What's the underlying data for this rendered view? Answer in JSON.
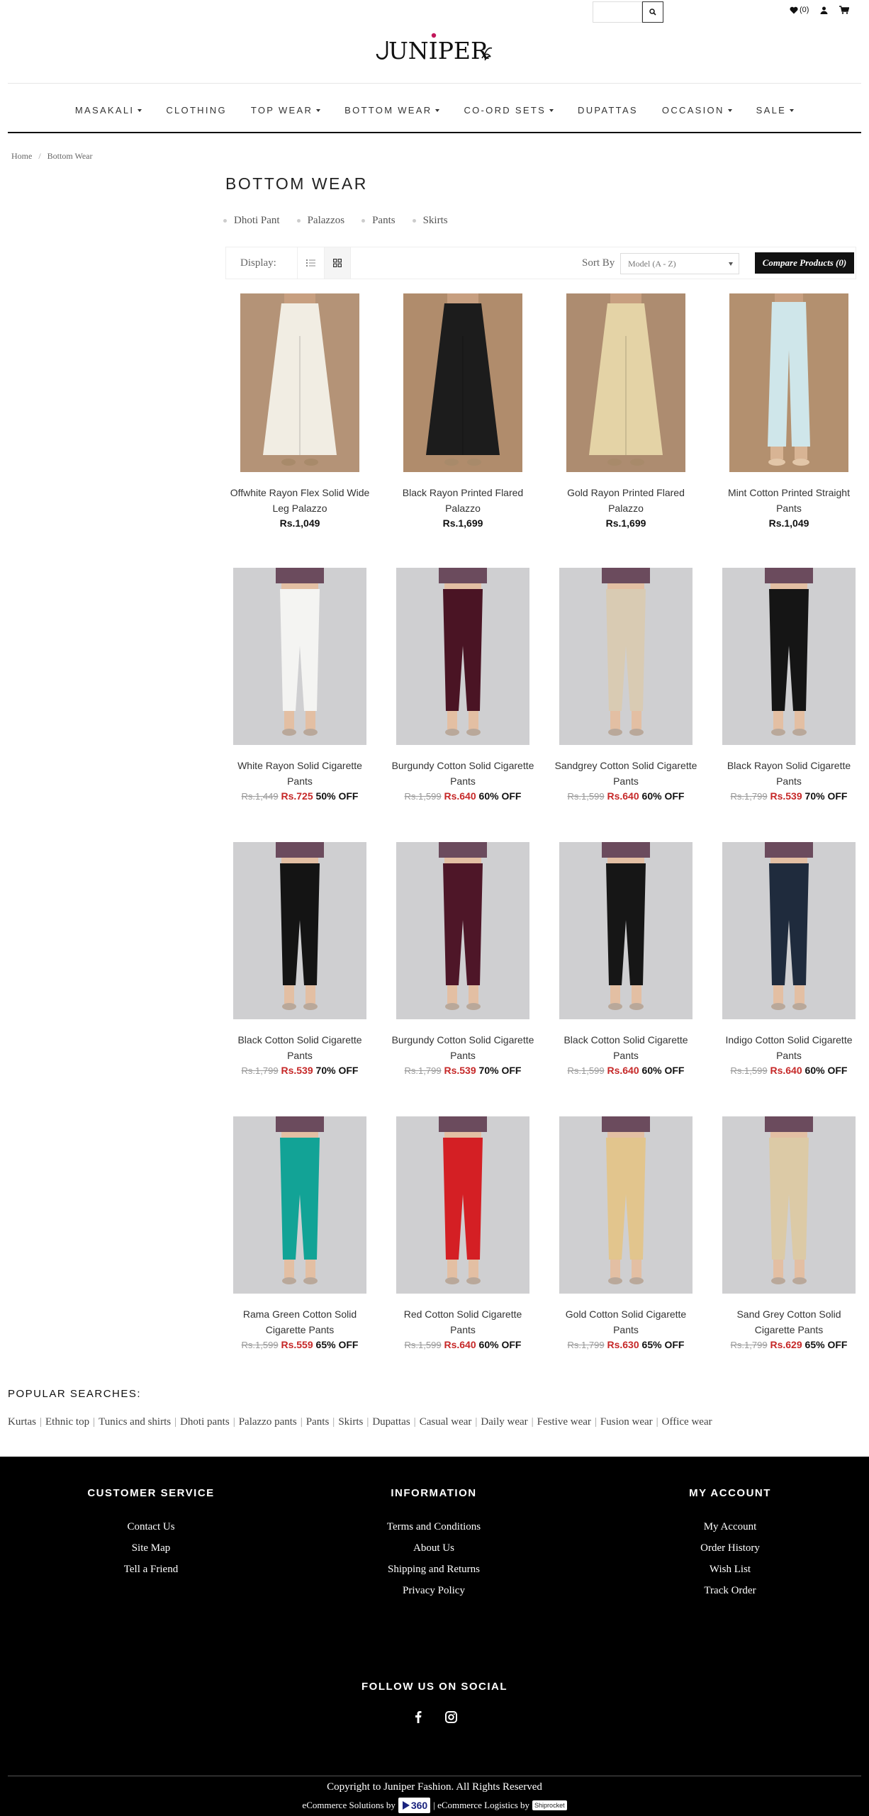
{
  "brand": {
    "logo_text": "JUNIPER"
  },
  "topbar": {
    "wishlist_count": "(0)"
  },
  "nav": [
    {
      "label": "MASAKALI",
      "dropdown": true
    },
    {
      "label": "CLOTHING",
      "dropdown": false
    },
    {
      "label": "TOP WEAR",
      "dropdown": true
    },
    {
      "label": "BOTTOM WEAR",
      "dropdown": true
    },
    {
      "label": "CO-ORD SETS",
      "dropdown": true
    },
    {
      "label": "DUPATTAS",
      "dropdown": false
    },
    {
      "label": "OCCASION",
      "dropdown": true
    },
    {
      "label": "SALE",
      "dropdown": true
    }
  ],
  "breadcrumb": {
    "home": "Home",
    "separator": "/",
    "current": "Bottom Wear"
  },
  "page_title": "BOTTOM WEAR",
  "subcategories": [
    "Dhoti Pant",
    "Palazzos",
    "Pants",
    "Skirts"
  ],
  "toolbar": {
    "display_label": "Display:",
    "sort_label": "Sort By",
    "sort_value": "Model (A - Z)",
    "compare_label": "Compare Products (0)"
  },
  "products": [
    {
      "name": "Offwhite Rayon Flex Solid Wide Leg Palazzo",
      "price": "Rs.1,049",
      "bg": "#b49377",
      "cloth": "#f1ede3",
      "style": "palazzo"
    },
    {
      "name": "Black Rayon Printed Flared Palazzo",
      "price": "Rs.1,699",
      "bg": "#b08c6c",
      "cloth": "#1c1c1c",
      "style": "palazzo"
    },
    {
      "name": "Gold Rayon Printed Flared Palazzo",
      "price": "Rs.1,699",
      "bg": "#ad8c70",
      "cloth": "#e4d3a6",
      "style": "palazzo"
    },
    {
      "name": "Mint Cotton Printed Straight Pants",
      "price": "Rs.1,049",
      "bg": "#b3906f",
      "cloth": "#cfe6ea",
      "style": "straight"
    },
    {
      "name": "White Rayon Solid Cigarette Pants",
      "old": "Rs.1,449",
      "new": "Rs.725",
      "off": "50% OFF",
      "bg": "#cfcfd1",
      "cloth": "#f4f4f2",
      "style": "cig"
    },
    {
      "name": "Burgundy Cotton Solid Cigarette Pants",
      "old": "Rs.1,599",
      "new": "Rs.640",
      "off": "60% OFF",
      "bg": "#cfcfd1",
      "cloth": "#4a1424",
      "style": "cig"
    },
    {
      "name": "Sandgrey Cotton Solid Cigarette Pants",
      "old": "Rs.1,599",
      "new": "Rs.640",
      "off": "60% OFF",
      "bg": "#cfcfd1",
      "cloth": "#d9cbb3",
      "style": "cig"
    },
    {
      "name": "Black Rayon Solid Cigarette Pants",
      "old": "Rs.1,799",
      "new": "Rs.539",
      "off": "70% OFF",
      "bg": "#cfcfd1",
      "cloth": "#151515",
      "style": "cig"
    },
    {
      "name": "Black Cotton Solid Cigarette Pants",
      "old": "Rs.1,799",
      "new": "Rs.539",
      "off": "70% OFF",
      "bg": "#cfcfd1",
      "cloth": "#141414",
      "style": "cig"
    },
    {
      "name": "Burgundy Cotton Solid Cigarette Pants",
      "old": "Rs.1,799",
      "new": "Rs.539",
      "off": "70% OFF",
      "bg": "#cfcfd1",
      "cloth": "#4e1628",
      "style": "cig"
    },
    {
      "name": "Black Cotton Solid Cigarette Pants",
      "old": "Rs.1,599",
      "new": "Rs.640",
      "off": "60% OFF",
      "bg": "#cfcfd1",
      "cloth": "#161616",
      "style": "cig"
    },
    {
      "name": "Indigo Cotton Solid Cigarette Pants",
      "old": "Rs.1,599",
      "new": "Rs.640",
      "off": "60% OFF",
      "bg": "#cfcfd1",
      "cloth": "#1f2b3d",
      "style": "cig"
    },
    {
      "name": "Rama Green Cotton Solid Cigarette Pants",
      "old": "Rs.1,599",
      "new": "Rs.559",
      "off": "65% OFF",
      "bg": "#cfcfd1",
      "cloth": "#12a396",
      "style": "cig"
    },
    {
      "name": "Red Cotton Solid Cigarette Pants",
      "old": "Rs.1,599",
      "new": "Rs.640",
      "off": "60% OFF",
      "bg": "#cfcfd1",
      "cloth": "#d41f24",
      "style": "cig"
    },
    {
      "name": "Gold Cotton Solid Cigarette Pants",
      "old": "Rs.1,799",
      "new": "Rs.630",
      "off": "65% OFF",
      "bg": "#cfcfd1",
      "cloth": "#e2c58d",
      "style": "cig"
    },
    {
      "name": "Sand Grey Cotton Solid Cigarette Pants",
      "old": "Rs.1,799",
      "new": "Rs.629",
      "off": "65% OFF",
      "bg": "#cfcfd1",
      "cloth": "#dccaa6",
      "style": "cig"
    }
  ],
  "popular": {
    "title": "POPULAR SEARCHES:",
    "links": [
      "Kurtas",
      "Ethnic top",
      "Tunics and shirts",
      "Dhoti pants",
      "Palazzo pants",
      "Pants",
      "Skirts",
      "Dupattas",
      "Casual wear",
      "Daily wear",
      "Festive wear",
      "Fusion wear",
      "Office wear"
    ]
  },
  "footer": {
    "customer_service": {
      "title": "CUSTOMER SERVICE",
      "links": [
        "Contact Us",
        "Site Map",
        "Tell a Friend"
      ]
    },
    "information": {
      "title": "INFORMATION",
      "links": [
        "Terms and Conditions",
        "About Us",
        "Shipping and Returns",
        "Privacy Policy"
      ]
    },
    "my_account": {
      "title": "MY ACCOUNT",
      "links": [
        "My Account",
        "Order History",
        "Wish List",
        "Track Order"
      ]
    },
    "follow_title": "FOLLOW US ON SOCIAL",
    "copyright": "Copyright to Juniper Fashion. All Rights Reserved",
    "ecommerce_solutions": "eCommerce Solutions by",
    "badge_360": "360",
    "ecommerce_logistics": "| eCommerce Logistics by",
    "badge_ship": "Shiprocket"
  }
}
